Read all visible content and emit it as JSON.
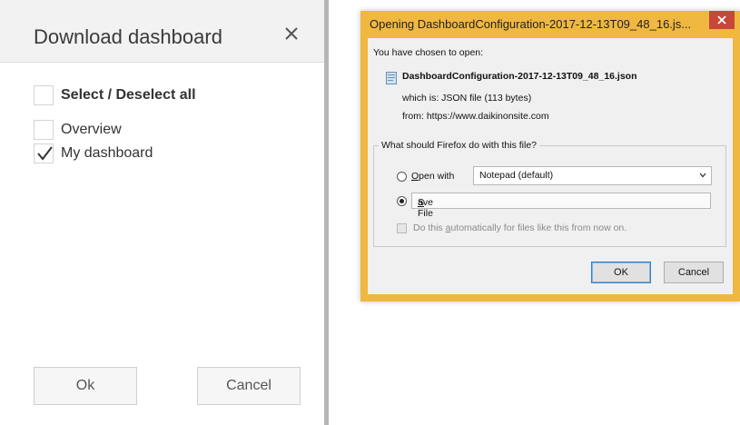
{
  "dashboard_dialog": {
    "title": "Download dashboard",
    "close_icon": "close-icon",
    "select_all_label": "Select / Deselect all",
    "items": [
      {
        "label": "Overview",
        "checked": false
      },
      {
        "label": "My dashboard",
        "checked": true
      }
    ],
    "ok_label": "Ok",
    "cancel_label": "Cancel"
  },
  "firefox_dialog": {
    "title": "Opening DashboardConfiguration-2017-12-13T09_48_16.js...",
    "intro": "You have chosen to open:",
    "file_icon": "json-file-icon",
    "file_name": "DashboardConfiguration-2017-12-13T09_48_16.json",
    "which_is": "which is:  JSON file (113 bytes)",
    "from": "from:  https://www.daikinonsite.com",
    "question": "What should Firefox do with this file?",
    "open_with_label_prefix": "O",
    "open_with_label_rest": "pen with",
    "open_with_app": "Notepad (default)",
    "save_file_prefix": "S",
    "save_file_rest": "ave File",
    "selected_action": "save",
    "auto_label_pre": "Do this ",
    "auto_label_u": "a",
    "auto_label_post": "utomatically for files like this from now on.",
    "ok_label": "OK",
    "cancel_label": "Cancel",
    "accent_color": "#f0b840",
    "close_color": "#c7483b"
  }
}
